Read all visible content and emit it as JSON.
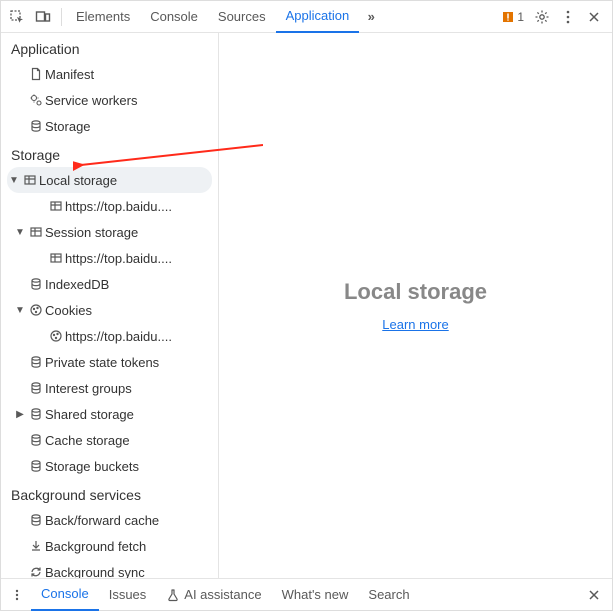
{
  "topbar": {
    "tabs": {
      "elements": "Elements",
      "console": "Console",
      "sources": "Sources",
      "application": "Application"
    },
    "error_count": "1"
  },
  "sidebar": {
    "section1": "Application",
    "app": {
      "manifest": "Manifest",
      "service_workers": "Service workers",
      "storage": "Storage"
    },
    "section2": "Storage",
    "storage": {
      "local_storage": "Local storage",
      "local_child": "https://top.baidu....",
      "session_storage": "Session storage",
      "session_child": "https://top.baidu....",
      "indexeddb": "IndexedDB",
      "cookies": "Cookies",
      "cookies_child": "https://top.baidu....",
      "private_state": "Private state tokens",
      "interest_groups": "Interest groups",
      "shared_storage": "Shared storage",
      "cache_storage": "Cache storage",
      "storage_buckets": "Storage buckets"
    },
    "section3": "Background services",
    "bg": {
      "bf_cache": "Back/forward cache",
      "bg_fetch": "Background fetch",
      "bg_sync": "Background sync"
    }
  },
  "content": {
    "title": "Local storage",
    "learn_more": "Learn more"
  },
  "bottombar": {
    "console": "Console",
    "issues": "Issues",
    "ai": "AI assistance",
    "whats_new": "What's new",
    "search": "Search"
  }
}
